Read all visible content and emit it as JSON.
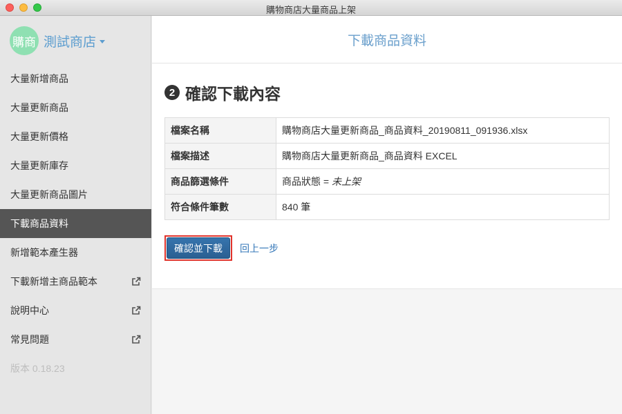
{
  "window": {
    "title": "購物商店大量商品上架"
  },
  "sidebar": {
    "avatar_text": "購商",
    "shop_name": "測試商店",
    "items": [
      {
        "label": "大量新增商品",
        "external": false,
        "active": false
      },
      {
        "label": "大量更新商品",
        "external": false,
        "active": false
      },
      {
        "label": "大量更新價格",
        "external": false,
        "active": false
      },
      {
        "label": "大量更新庫存",
        "external": false,
        "active": false
      },
      {
        "label": "大量更新商品圖片",
        "external": false,
        "active": false
      },
      {
        "label": "下載商品資料",
        "external": false,
        "active": true
      },
      {
        "label": "新增範本產生器",
        "external": false,
        "active": false
      },
      {
        "label": "下載新增主商品範本",
        "external": true,
        "active": false
      },
      {
        "label": "說明中心",
        "external": true,
        "active": false
      },
      {
        "label": "常見問題",
        "external": true,
        "active": false
      }
    ],
    "version": "版本 0.18.23"
  },
  "main": {
    "header_title": "下載商品資料",
    "step_number": "2",
    "step_title": "確認下載內容",
    "table": [
      {
        "key": "檔案名稱",
        "value": "購物商店大量更新商品_商品資料_20190811_091936.xlsx"
      },
      {
        "key": "檔案描述",
        "value": "購物商店大量更新商品_商品資料 EXCEL"
      },
      {
        "key": "商品篩選條件",
        "value_prefix": "商品狀態 = ",
        "value_em": "未上架"
      },
      {
        "key": "符合條件筆數",
        "value": "840 筆"
      }
    ],
    "confirm_button": "確認並下載",
    "back_link": "回上一步"
  },
  "colors": {
    "accent": "#5c9dcf",
    "primary_button": "#2e6aa3",
    "highlight_border": "#e0322a",
    "active_nav": "#555555"
  }
}
